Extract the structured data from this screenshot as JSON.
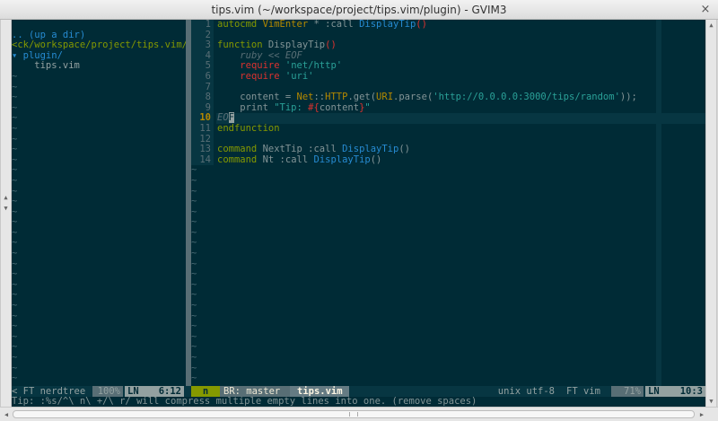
{
  "window": {
    "title": "tips.vim (~/workspace/project/tips.vim/plugin) - GVIM3",
    "close_glyph": "×"
  },
  "nerdtree": {
    "lines": [
      {
        "text": ".. (up a dir)",
        "kind": "up"
      },
      {
        "text": "<ck/workspace/project/tips.vim/",
        "kind": "root"
      },
      {
        "text": "▾ plugin/",
        "kind": "dir"
      },
      {
        "text": "    tips.vim",
        "kind": "file"
      }
    ],
    "tilde": "~"
  },
  "editor": {
    "lines": [
      {
        "n": "1",
        "tokens": [
          [
            "autocmd ",
            "kw"
          ],
          [
            "VimEnter",
            "type"
          ],
          [
            " * :call ",
            "tx"
          ],
          [
            "DisplayTip",
            "fn"
          ],
          [
            "()",
            "special"
          ]
        ]
      },
      {
        "n": "2",
        "tokens": []
      },
      {
        "n": "3",
        "tokens": [
          [
            "function ",
            "kw"
          ],
          [
            "DisplayTip",
            "tx"
          ],
          [
            "()",
            "special"
          ]
        ]
      },
      {
        "n": "4",
        "tokens": [
          [
            "    ",
            "tx"
          ],
          [
            "ruby << EOF",
            "cmt"
          ]
        ]
      },
      {
        "n": "5",
        "tokens": [
          [
            "    ",
            "tx"
          ],
          [
            "require ",
            "special"
          ],
          [
            "'net/http'",
            "str"
          ]
        ]
      },
      {
        "n": "6",
        "tokens": [
          [
            "    ",
            "tx"
          ],
          [
            "require ",
            "special"
          ],
          [
            "'uri'",
            "str"
          ]
        ]
      },
      {
        "n": "7",
        "tokens": []
      },
      {
        "n": "8",
        "tokens": [
          [
            "    content = ",
            "tx"
          ],
          [
            "Net",
            "type"
          ],
          [
            "::",
            "tx"
          ],
          [
            "HTTP",
            "type"
          ],
          [
            ".get(",
            "tx"
          ],
          [
            "URI",
            "type"
          ],
          [
            ".parse(",
            "tx"
          ],
          [
            "'http://0.0.0.0:3000/tips/random'",
            "str"
          ],
          [
            "));",
            "tx"
          ]
        ]
      },
      {
        "n": "9",
        "tokens": [
          [
            "    print ",
            "tx"
          ],
          [
            "\"Tip: ",
            "str"
          ],
          [
            "#{",
            "special"
          ],
          [
            "content",
            "tx"
          ],
          [
            "}",
            "special"
          ],
          [
            "\"",
            "str"
          ]
        ]
      },
      {
        "n": "10",
        "tokens": [
          [
            "EO",
            "cmt"
          ],
          [
            "F",
            "cursor"
          ]
        ],
        "current": true
      },
      {
        "n": "11",
        "tokens": [
          [
            "endfunction",
            "kw"
          ]
        ]
      },
      {
        "n": "12",
        "tokens": []
      },
      {
        "n": "13",
        "tokens": [
          [
            "command ",
            "kw"
          ],
          [
            "NextTip",
            "tx"
          ],
          [
            " :call ",
            "tx"
          ],
          [
            "DisplayTip",
            "fn"
          ],
          [
            "()",
            "tx"
          ]
        ]
      },
      {
        "n": "14",
        "tokens": [
          [
            "command ",
            "kw"
          ],
          [
            "Nt",
            "tx"
          ],
          [
            " :call ",
            "tx"
          ],
          [
            "DisplayTip",
            "fn"
          ],
          [
            "()",
            "tx"
          ]
        ]
      }
    ]
  },
  "statusline": {
    "left_ft": "< FT nerdtree",
    "left_pct": "100%",
    "left_ln_label": "LN",
    "left_ln": "6:12",
    "mode": "n",
    "branch": "BR: master",
    "file": "tips.vim",
    "encoding": "unix utf-8",
    "ft": "FT vim",
    "pct": "71%",
    "ln_label": "LN",
    "ln": "10:3"
  },
  "cmdline": "Tip: :%s/^\\ n\\ +/\\ r/ will compress multiple empty lines into one. (remove spaces)",
  "colors": {
    "background": "#002b36",
    "accent_green": "#859900",
    "accent_blue": "#268bd2",
    "string": "#2aa198"
  },
  "icons": {
    "close": "close-icon",
    "scroll_up": "arrow-up-icon",
    "scroll_down": "arrow-down-icon",
    "scroll_left": "arrow-left-icon",
    "scroll_right": "arrow-right-icon"
  }
}
